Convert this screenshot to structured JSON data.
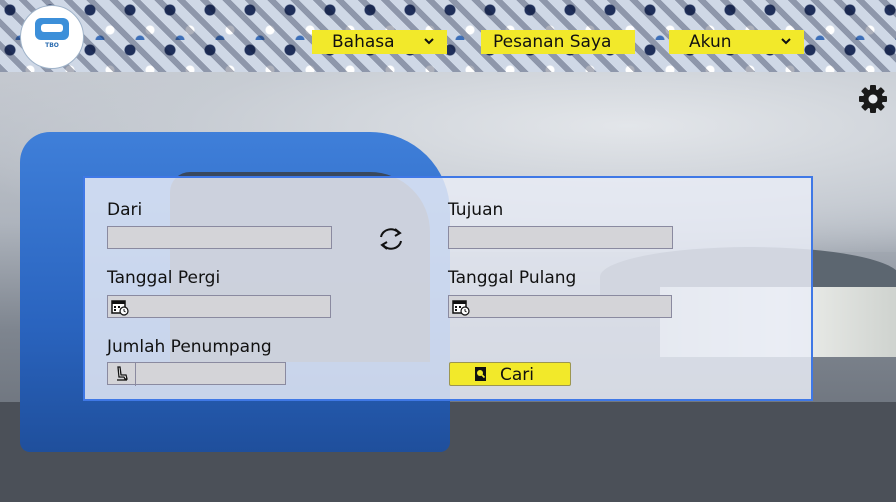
{
  "header": {
    "logo_text": "TBO",
    "nav": [
      {
        "label": "Bahasa",
        "icon": "chevron-down-icon"
      },
      {
        "label": "Pesanan Saya"
      },
      {
        "label": "Akun",
        "icon": "chevron-down-icon"
      }
    ]
  },
  "settings": {
    "icon": "gear-icon"
  },
  "form": {
    "from_label": "Dari",
    "from_value": "",
    "to_label": "Tujuan",
    "to_value": "",
    "swap_icon": "swap-icon",
    "depart_label": "Tanggal Pergi",
    "depart_value": "",
    "return_label": "Tanggal Pulang",
    "return_value": "",
    "passengers_label": "Jumlah Penumpang",
    "passengers_value": "",
    "search_button": "Cari"
  },
  "colors": {
    "accent_yellow": "#f2e92a",
    "panel_border": "#3f78e6",
    "input_bg": "#d4d4d8"
  }
}
